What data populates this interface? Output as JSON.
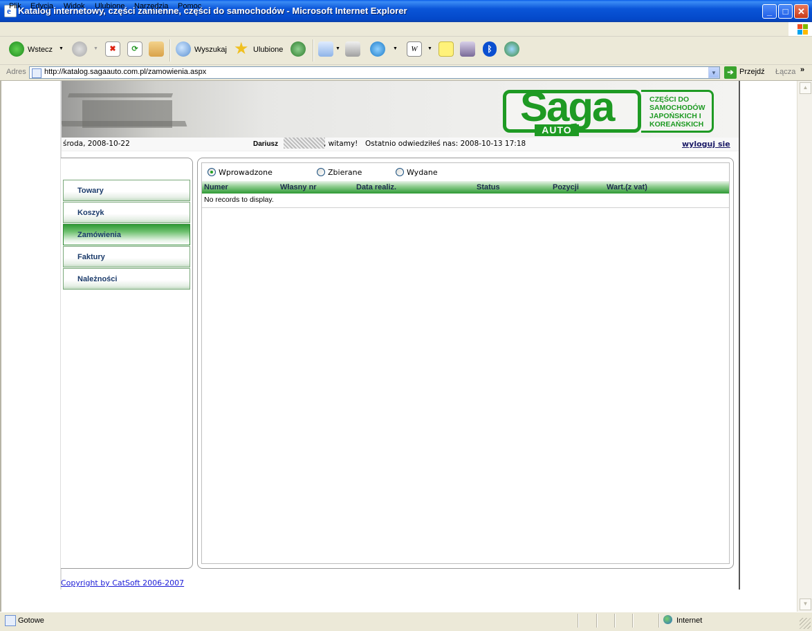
{
  "window": {
    "title": "Katalog internetowy, części zamienne, części do samochodów - Microsoft Internet Explorer"
  },
  "menubar": {
    "items": [
      "Plik",
      "Edycja",
      "Widok",
      "Ulubione",
      "Narzędzia",
      "Pomoc"
    ]
  },
  "toolbar": {
    "back": "Wstecz",
    "search": "Wyszukaj",
    "favorites": "Ulubione"
  },
  "address": {
    "label": "Adres",
    "url": "http://katalog.sagaauto.com.pl/zamowienia.aspx",
    "go": "Przejdź",
    "links": "Łącza"
  },
  "logo": {
    "main": "Saga",
    "sub": "AUTO",
    "tagline": "CZĘŚCI DO SAMOCHODÓW JAPOŃSKICH I KOREAŃSKICH"
  },
  "infobar": {
    "date": "środa, 2008-10-22",
    "user": "Dariusz",
    "welcome": ", witamy!",
    "last_visit": "Ostatnio odwiedziłeś nas: 2008-10-13 17:18",
    "logout": "wyloguj sie"
  },
  "nav": {
    "items": [
      "Towary",
      "Koszyk",
      "Zamówienia",
      "Faktury",
      "Należności"
    ],
    "active": "Zamówienia"
  },
  "filters": {
    "options": [
      "Wprowadzone",
      "Zbierane",
      "Wydane"
    ],
    "selected": "Wprowadzone"
  },
  "grid": {
    "columns": [
      "Numer",
      "Własny nr",
      "Data realiz.",
      "Status",
      "Pozycji",
      "Wart.(z vat)"
    ],
    "empty": "No records to display."
  },
  "footer": {
    "copyright": "Copyright by CatSoft 2006-2007"
  },
  "status": {
    "text": "Gotowe",
    "zone": "Internet"
  },
  "colors": {
    "brand": "#1e9a23",
    "titlebar": "#0a55d8"
  }
}
